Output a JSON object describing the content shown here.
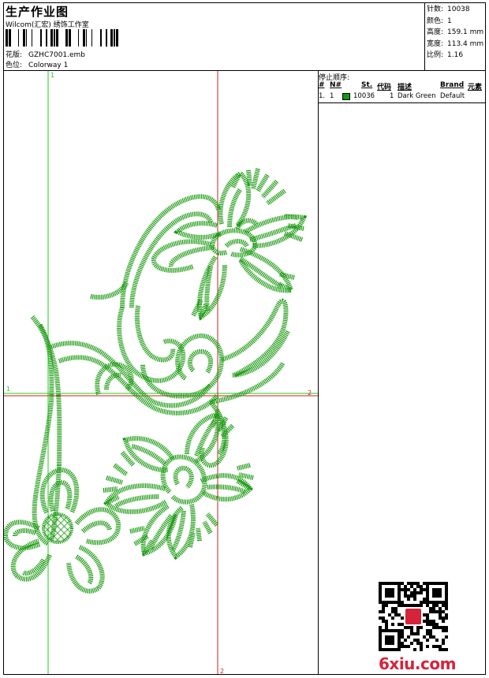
{
  "header": {
    "title": "生产作业图",
    "company": "Wilcom(汇宏) 绣饰工作室",
    "design_label": "花版:",
    "design_value": "GZHC7001.emb",
    "colorway_label": "色位:",
    "colorway_value": "Colorway 1"
  },
  "stats": [
    {
      "label": "针数:",
      "value": "10038"
    },
    {
      "label": "颜色:",
      "value": "1"
    },
    {
      "label": "高度:",
      "value": "159.1 mm"
    },
    {
      "label": "宽度:",
      "value": "113.4 mm"
    },
    {
      "label": "比例:",
      "value": "1.16"
    }
  ],
  "stops": {
    "title": "停止顺序:",
    "columns": [
      "#",
      "N#",
      "St.",
      "代码",
      "描述",
      "Brand",
      "元素"
    ],
    "rows": [
      {
        "index": "1.",
        "n": "1",
        "stitches": "10036",
        "code": "1",
        "description": "Dark Green",
        "brand": "Default",
        "color": "#119911"
      }
    ]
  },
  "guides": {
    "v1": "1",
    "h1": "1",
    "h2": "2",
    "v2": "2"
  },
  "watermark": "6xiu.com",
  "colors": {
    "thread": "#1a9a10",
    "guide_green": "#22cc22",
    "guide_red": "#cc2222"
  }
}
